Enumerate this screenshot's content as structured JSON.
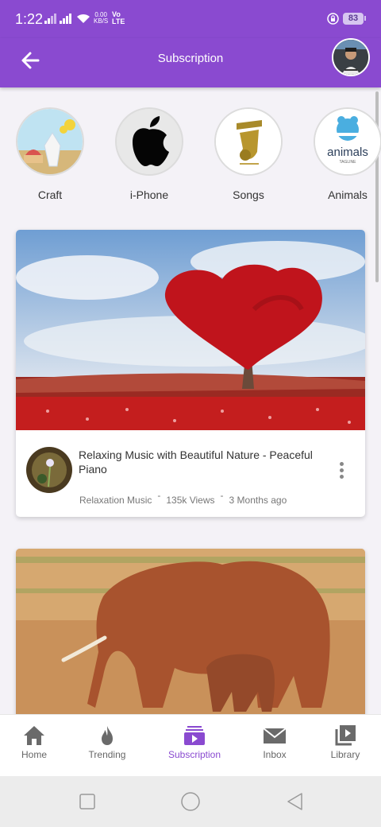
{
  "status": {
    "time": "1:22",
    "net_speed": "0.00",
    "net_unit": "KB/S",
    "volte_top": "Vo",
    "volte_bottom": "LTE",
    "battery": "83"
  },
  "header": {
    "title": "Subscription"
  },
  "categories": [
    {
      "label": "Craft"
    },
    {
      "label": "i-Phone"
    },
    {
      "label": "Songs"
    },
    {
      "label": "Animals",
      "logo_text": "animals",
      "logo_tagline": "TAGLINE"
    }
  ],
  "videos": [
    {
      "title": "Relaxing Music with Beautiful Nature - Peaceful Piano",
      "channel": "Relaxation Music",
      "views": "135k Views",
      "age": "3 Months ago",
      "separator": "-"
    }
  ],
  "nav": {
    "items": [
      {
        "label": "Home",
        "icon": "home-icon"
      },
      {
        "label": "Trending",
        "icon": "flame-icon"
      },
      {
        "label": "Subscription",
        "icon": "subscription-icon",
        "active": true
      },
      {
        "label": "Inbox",
        "icon": "mail-icon"
      },
      {
        "label": "Library",
        "icon": "library-icon"
      }
    ]
  },
  "colors": {
    "accent": "#8a4ad0",
    "background": "#f4f2f7"
  }
}
